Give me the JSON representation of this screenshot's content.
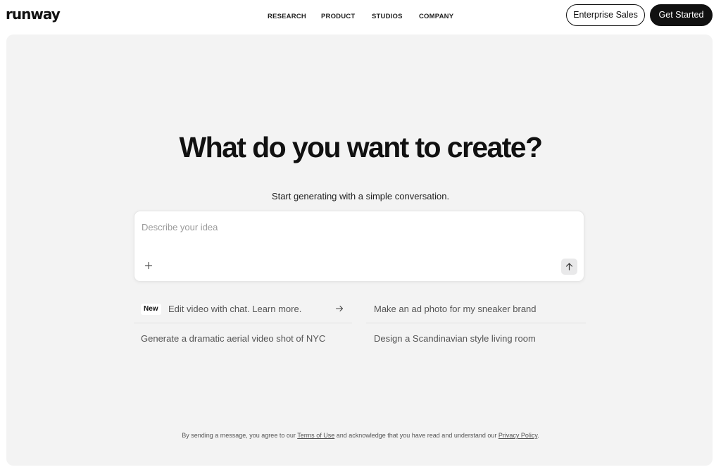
{
  "header": {
    "logo": "runway",
    "nav": [
      "RESEARCH",
      "PRODUCT",
      "STUDIOS",
      "COMPANY"
    ],
    "enterprise_label": "Enterprise Sales",
    "get_started_label": "Get Started"
  },
  "hero": {
    "title": "What do you want to create?",
    "subtitle": "Start generating with a simple conversation."
  },
  "composer": {
    "placeholder": "Describe your idea",
    "value": ""
  },
  "suggestions": {
    "badge": "New",
    "items": [
      "Edit video with chat. Learn more.",
      "Make an ad photo for my sneaker brand",
      "Generate a dramatic aerial video shot of NYC",
      "Design a Scandinavian style living room"
    ]
  },
  "legal": {
    "prefix": "By sending a message, you agree to our ",
    "terms": "Terms of Use",
    "middle": " and acknowledge that you have read and understand our ",
    "privacy": "Privacy Policy",
    "suffix": "."
  },
  "icons": {
    "plus": "plus-icon",
    "send": "arrow-up-icon",
    "arrow": "arrow-right-icon"
  }
}
